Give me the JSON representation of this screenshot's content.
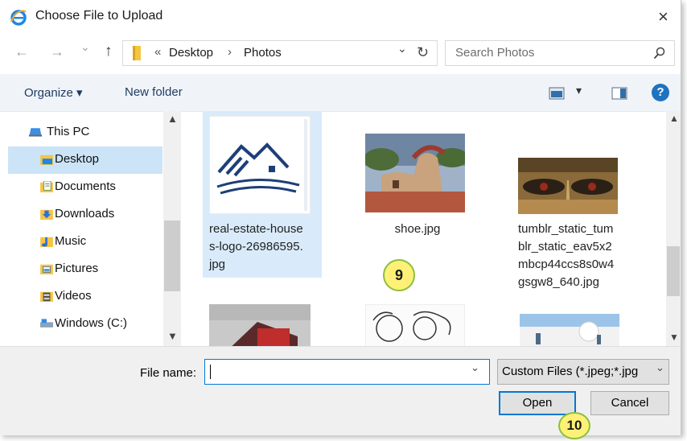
{
  "window": {
    "title": "Choose File to Upload",
    "close": "×"
  },
  "nav": {
    "back": "←",
    "forward": "→",
    "recent": "⌄",
    "up": "↑",
    "path_overflow": "«",
    "path_part_1": "Desktop",
    "path_sep": "›",
    "path_part_2": "Photos",
    "dropdown": "⌄",
    "refresh": "↻",
    "search_placeholder": "Search Photos"
  },
  "toolbar": {
    "organize": "Organize ▾",
    "new_folder": "New folder",
    "view_dropdown": "▾",
    "help": "?"
  },
  "sidebar": {
    "items": [
      {
        "label": "This PC",
        "icon": "computer-icon"
      },
      {
        "label": "Desktop",
        "icon": "folder-icon"
      },
      {
        "label": "Documents",
        "icon": "documents-icon"
      },
      {
        "label": "Downloads",
        "icon": "downloads-icon"
      },
      {
        "label": "Music",
        "icon": "music-icon"
      },
      {
        "label": "Pictures",
        "icon": "pictures-icon"
      },
      {
        "label": "Videos",
        "icon": "videos-icon"
      },
      {
        "label": "Windows (C:)",
        "icon": "drive-icon"
      }
    ]
  },
  "files": [
    {
      "name_lines": [
        "real-estate-house",
        "s-logo-26986595.",
        "jpg"
      ]
    },
    {
      "name_lines": [
        "shoe.jpg"
      ]
    },
    {
      "name_lines": [
        "tumblr_static_tum",
        "blr_static_eav5x2",
        "mbcp44ccs8s0w4",
        "gsgw8_640.jpg"
      ]
    }
  ],
  "footer": {
    "file_name_label": "File name:",
    "file_name_value": "",
    "filter_value": "Custom Files (*.jpeg;*.jpg",
    "open": "Open",
    "cancel": "Cancel"
  },
  "annotations": {
    "step_9": "9",
    "step_10": "10"
  },
  "colors": {
    "accent": "#0078d7",
    "selection": "#cce4f7",
    "badge_fill": "#fff176",
    "badge_border": "#8bbf3f"
  }
}
